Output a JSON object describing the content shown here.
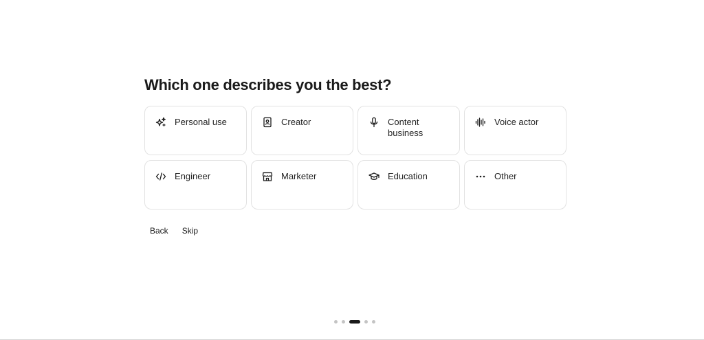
{
  "question": "Which one describes you the best?",
  "options": [
    {
      "label": "Personal use",
      "icon": "sparkles-icon"
    },
    {
      "label": "Creator",
      "icon": "portrait-book-icon"
    },
    {
      "label": "Content business",
      "icon": "microphone-icon"
    },
    {
      "label": "Voice actor",
      "icon": "waveform-icon"
    },
    {
      "label": "Engineer",
      "icon": "code-icon"
    },
    {
      "label": "Marketer",
      "icon": "storefront-icon"
    },
    {
      "label": "Education",
      "icon": "graduation-cap-icon"
    },
    {
      "label": "Other",
      "icon": "ellipsis-icon"
    }
  ],
  "actions": {
    "back_label": "Back",
    "skip_label": "Skip"
  },
  "progress": {
    "total_steps": 5,
    "current_step": 3
  },
  "colors": {
    "text": "#1a1a1a",
    "card_border": "#e2e2e2",
    "dot_inactive": "#c4c4c4",
    "dot_active": "#1a1a1a"
  }
}
